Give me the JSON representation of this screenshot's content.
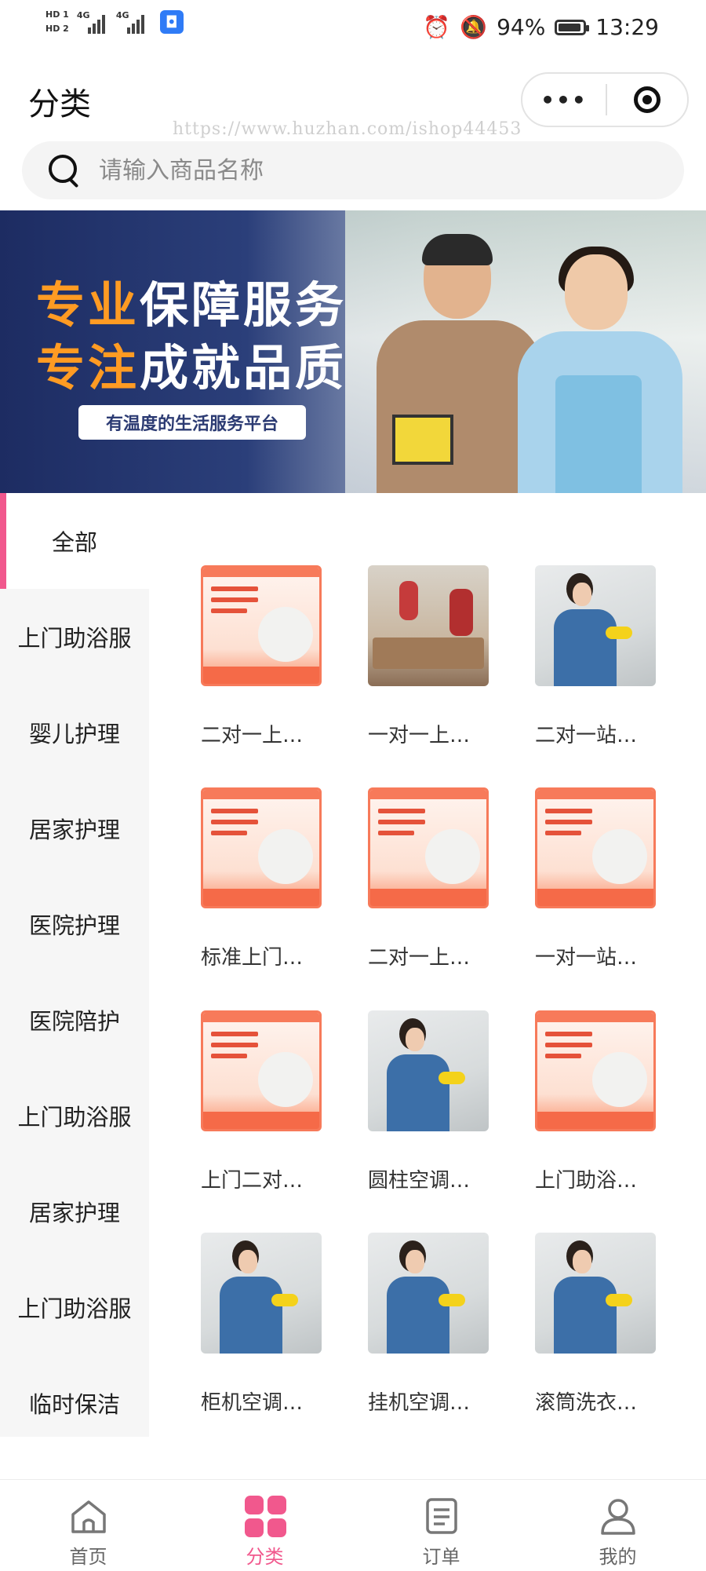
{
  "status_bar": {
    "sim1": "HD 1",
    "sim2": "HD 2",
    "net1": "4G",
    "net2": "4G",
    "battery": "94%",
    "battery_level": 0.94,
    "time": "13:29"
  },
  "header": {
    "title": "分类",
    "more_label": "•••",
    "watermark": "https://www.huzhan.com/ishop44453"
  },
  "search": {
    "placeholder": "请输入商品名称"
  },
  "banner": {
    "line1_accent": "专业",
    "line1_rest": "保障服务",
    "line2_accent": "专注",
    "line2_rest": "成就品质",
    "pill": "有温度的生活服务平台"
  },
  "sidebar": {
    "items": [
      {
        "label": "全部",
        "active": true
      },
      {
        "label": "上门助浴服",
        "active": false
      },
      {
        "label": "婴儿护理",
        "active": false
      },
      {
        "label": "居家护理",
        "active": false
      },
      {
        "label": "医院护理",
        "active": false
      },
      {
        "label": "医院陪护",
        "active": false
      },
      {
        "label": "上门助浴服",
        "active": false
      },
      {
        "label": "居家护理",
        "active": false
      },
      {
        "label": "上门助浴服",
        "active": false
      },
      {
        "label": "临时保洁",
        "active": false
      }
    ]
  },
  "products": [
    {
      "name": "二对一上…",
      "image": "elderly-care-poster"
    },
    {
      "name": "一对一上…",
      "image": "workers-photo"
    },
    {
      "name": "二对一站…",
      "image": "cleaner-photo"
    },
    {
      "name": "标准上门…",
      "image": "elderly-care-poster"
    },
    {
      "name": "二对一上…",
      "image": "nursing-poster"
    },
    {
      "name": "一对一站…",
      "image": "patient-escort-poster"
    },
    {
      "name": "上门二对…",
      "image": "elderly-care-poster"
    },
    {
      "name": "圆柱空调…",
      "image": "cleaner-photo"
    },
    {
      "name": "上门助浴…",
      "image": "nursing-poster"
    },
    {
      "name": "柜机空调…",
      "image": "cleaner-photo"
    },
    {
      "name": "挂机空调…",
      "image": "cleaner-photo"
    },
    {
      "name": "滚筒洗衣…",
      "image": "cleaner-photo"
    }
  ],
  "tabbar": {
    "items": [
      {
        "label": "首页",
        "icon": "home-icon",
        "active": false
      },
      {
        "label": "分类",
        "icon": "category-icon",
        "active": true
      },
      {
        "label": "订单",
        "icon": "order-icon",
        "active": false
      },
      {
        "label": "我的",
        "icon": "user-icon",
        "active": false
      }
    ]
  },
  "colors": {
    "accent": "#f1588d",
    "banner_orange": "#ff9b23",
    "banner_navy": "#1d2c62"
  }
}
